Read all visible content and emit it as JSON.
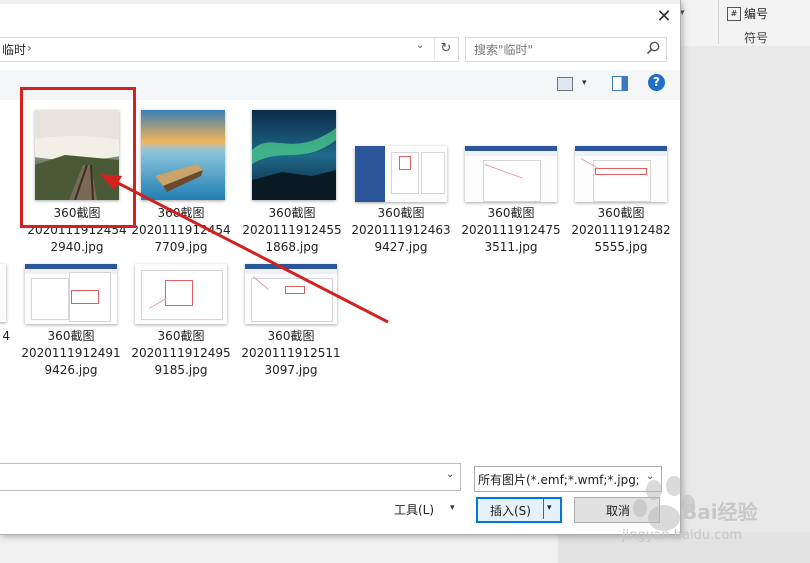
{
  "ribbon": {
    "numbering_label": "编号",
    "numbering_icon": "#",
    "symbols_group": "符号"
  },
  "dialog": {
    "close_glyph": "✕",
    "address": {
      "current": "临时",
      "separator": "›",
      "dropdown": "⌄",
      "refresh_glyph": "↻"
    },
    "search": {
      "placeholder": "搜索\"临时\""
    },
    "toolbar": {
      "view_dropdown": "▾",
      "help_glyph": "?"
    },
    "files": [
      {
        "name_line1": "360截图",
        "name_line2": "2020111912454",
        "name_line3": "2940.jpg"
      },
      {
        "name_line1": "360截图",
        "name_line2": "2020111912454",
        "name_line3": "7709.jpg"
      },
      {
        "name_line1": "360截图",
        "name_line2": "2020111912455",
        "name_line3": "1868.jpg"
      },
      {
        "name_line1": "360截图",
        "name_line2": "2020111912463",
        "name_line3": "9427.jpg"
      },
      {
        "name_line1": "360截图",
        "name_line2": "2020111912475",
        "name_line3": "3511.jpg"
      },
      {
        "name_line1": "360截图",
        "name_line2": "2020111912482",
        "name_line3": "5555.jpg"
      },
      {
        "name_line1": "",
        "name_line2": "4",
        "name_line3": ""
      },
      {
        "name_line1": "360截图",
        "name_line2": "2020111912491",
        "name_line3": "9426.jpg"
      },
      {
        "name_line1": "360截图",
        "name_line2": "2020111912495",
        "name_line3": "9185.jpg"
      },
      {
        "name_line1": "360截图",
        "name_line2": "2020111912511",
        "name_line3": "3097.jpg"
      }
    ],
    "filename_dropdown": "⌄",
    "filetype": {
      "value": "所有图片(*.emf;*.wmf;*.jpg;*.jp",
      "dropdown": "⌄"
    },
    "tools": {
      "label": "工具(L)",
      "dropdown": "▾"
    },
    "insert": {
      "label": "插入(S)",
      "dropdown": "▾"
    },
    "cancel": {
      "label": "取消"
    }
  },
  "watermark": {
    "brand": "Bai经验",
    "url": "jingyan.baidu.com"
  },
  "colors": {
    "highlight": "#d32020",
    "accent": "#0078d7",
    "help": "#1d6fc9"
  }
}
